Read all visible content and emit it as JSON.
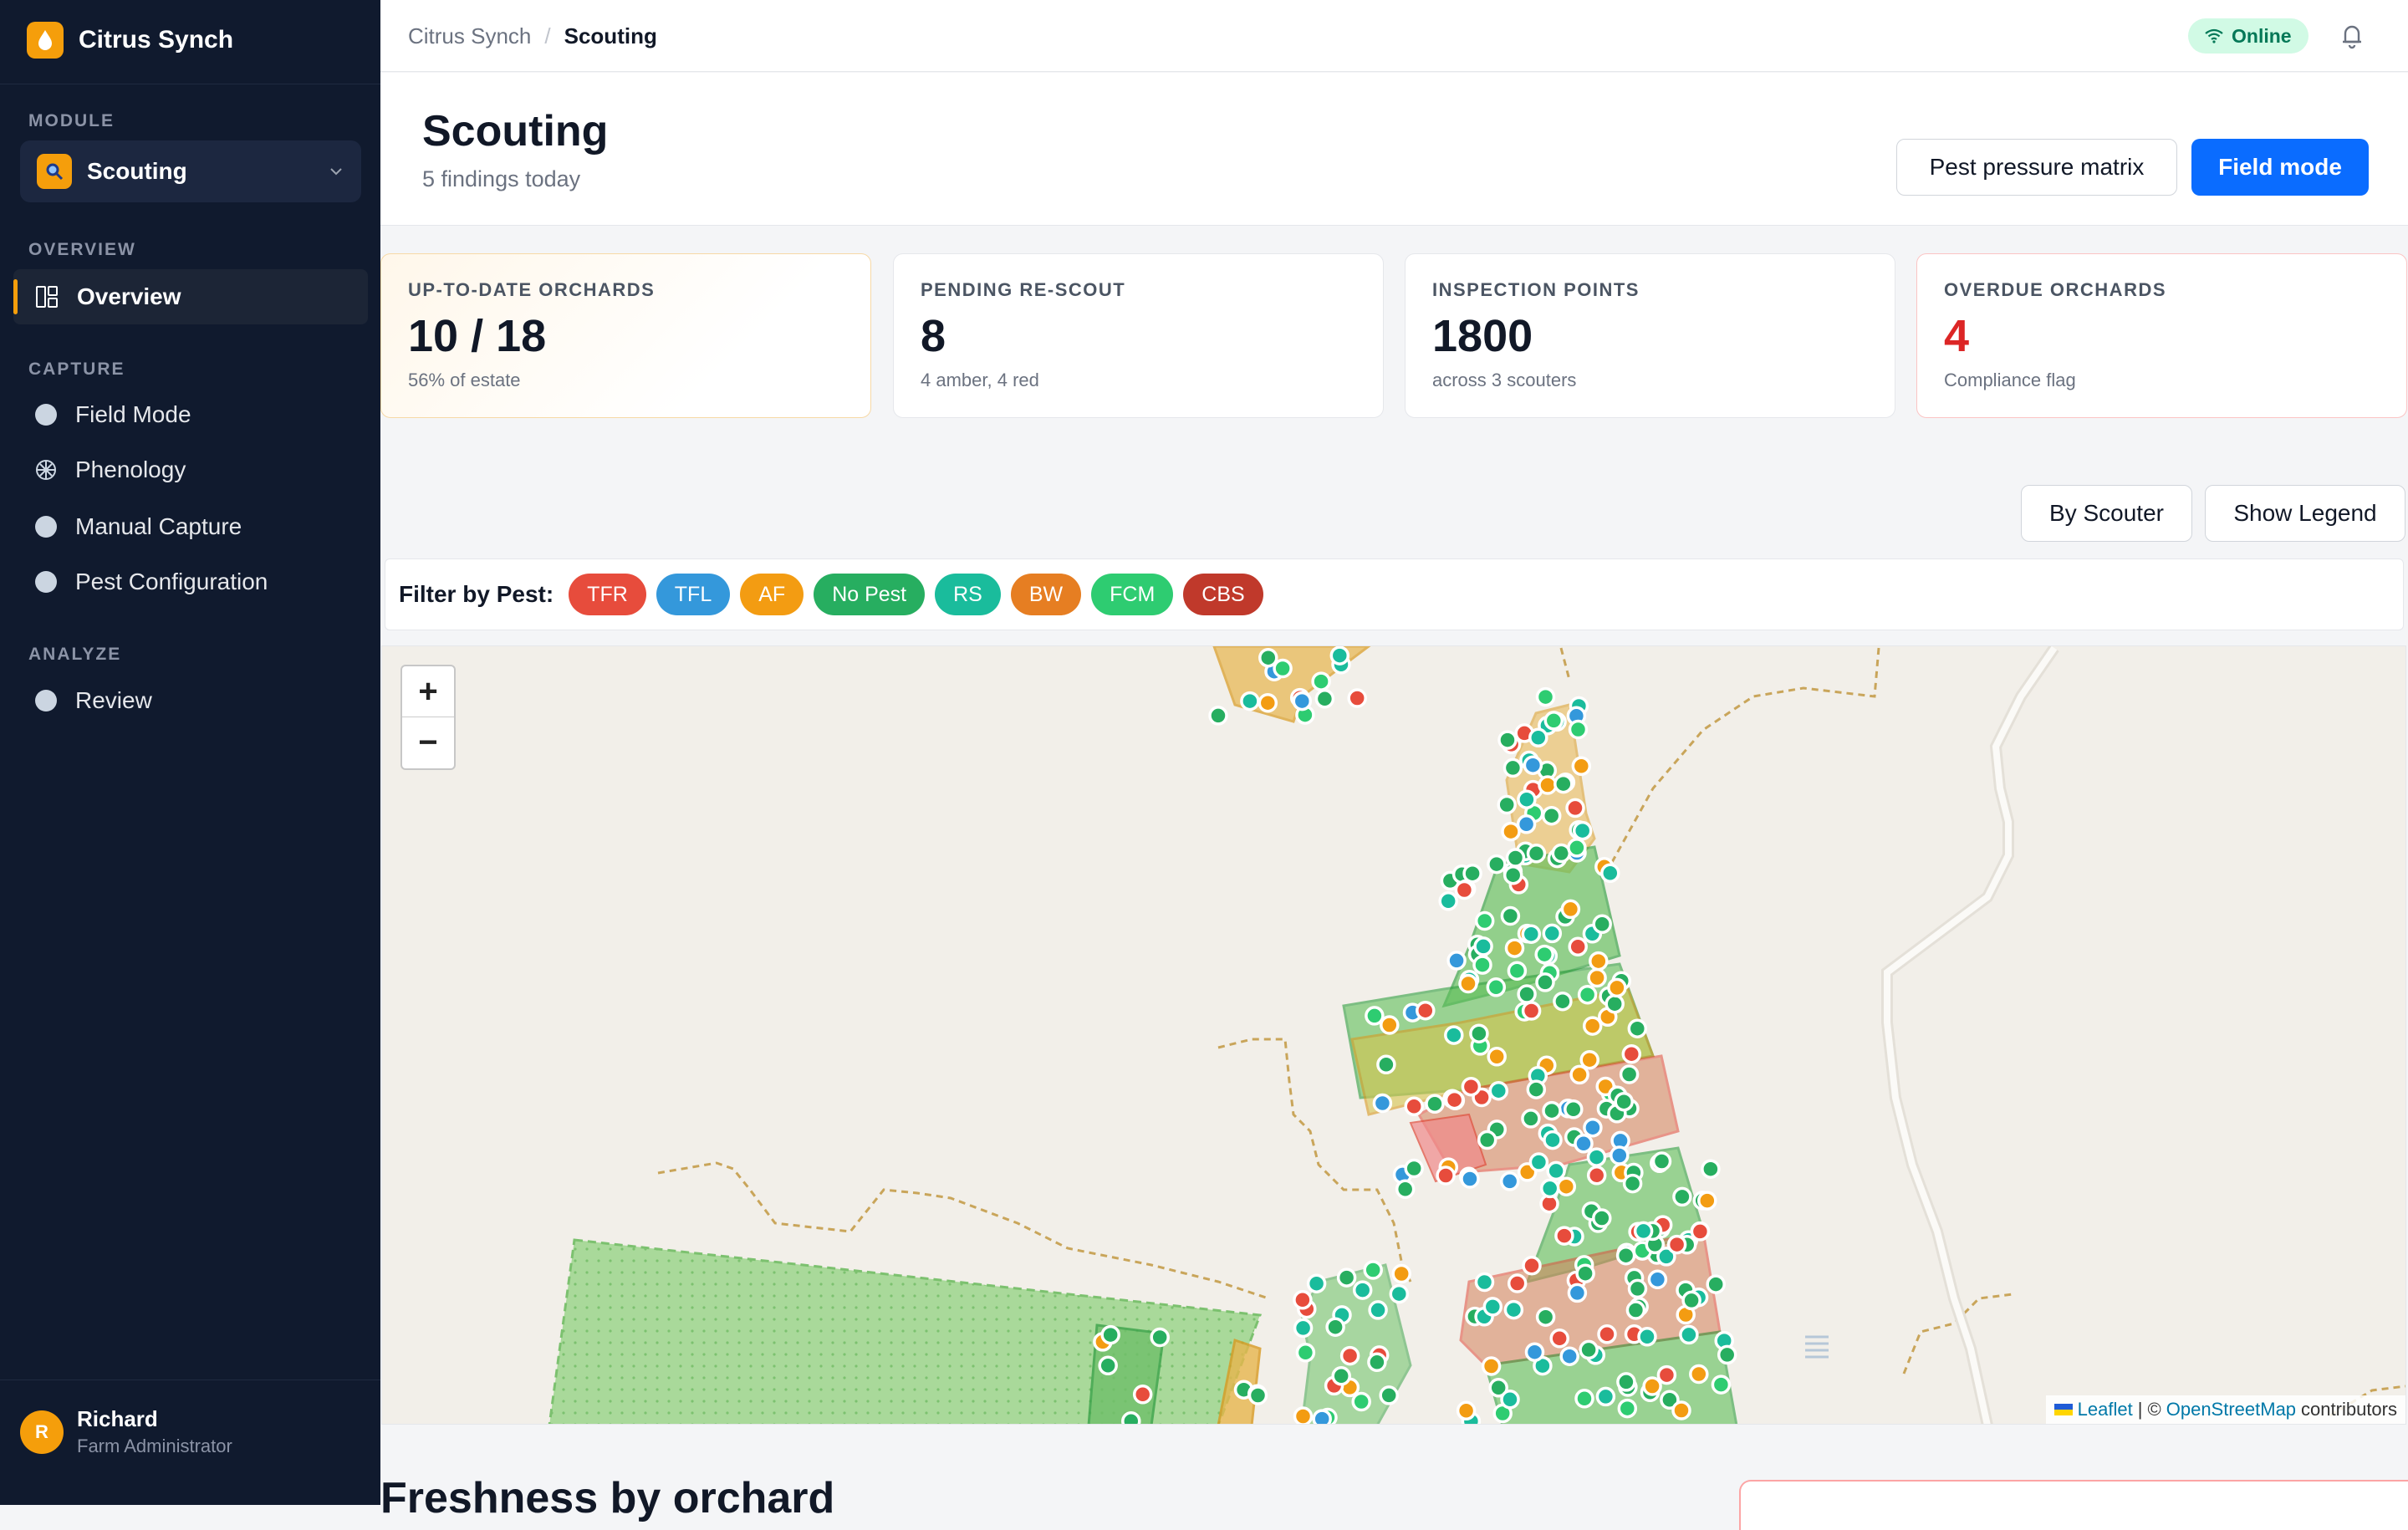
{
  "app": {
    "name": "Citrus Synch"
  },
  "sidebar": {
    "module_label": "MODULE",
    "module_value": "Scouting",
    "sections": [
      {
        "label": "OVERVIEW"
      },
      {
        "label": "CAPTURE"
      },
      {
        "label": "ANALYZE"
      }
    ],
    "items": [
      {
        "label": "Overview",
        "icon": "dashboard-icon",
        "active": true
      },
      {
        "label": "Field Mode",
        "icon": "circle-icon"
      },
      {
        "label": "Phenology",
        "icon": "flower-icon"
      },
      {
        "label": "Manual Capture",
        "icon": "circle-icon"
      },
      {
        "label": "Pest Configuration",
        "icon": "circle-icon"
      },
      {
        "label": "Review",
        "icon": "circle-icon"
      }
    ],
    "user": {
      "initial": "R",
      "name": "Richard",
      "role": "Farm Administrator"
    }
  },
  "topbar": {
    "breadcrumb": [
      "Citrus Synch",
      "/",
      "Scouting"
    ],
    "status": "Online",
    "status_color": "#047857"
  },
  "header": {
    "title": "Scouting",
    "subtitle": "5 findings today",
    "btn_matrix": "Pest pressure matrix",
    "btn_field": "Field mode"
  },
  "stats": [
    {
      "label": "UP-TO-DATE ORCHARDS",
      "value": "10 / 18",
      "sub": "56% of estate"
    },
    {
      "label": "PENDING RE-SCOUT",
      "value": "8",
      "sub": "4 amber, 4 red"
    },
    {
      "label": "INSPECTION POINTS",
      "value": "1800",
      "sub": "across 3 scouters"
    },
    {
      "label": "OVERDUE ORCHARDS",
      "value": "4",
      "sub": "Compliance flag"
    }
  ],
  "map_controls": {
    "by_scouter": "By Scouter",
    "show_legend": "Show Legend"
  },
  "filter": {
    "label": "Filter by Pest:",
    "chips": [
      {
        "label": "TFR",
        "color": "#e74c3c"
      },
      {
        "label": "TFL",
        "color": "#3498db"
      },
      {
        "label": "AF",
        "color": "#f39c12"
      },
      {
        "label": "No Pest",
        "color": "#27ae60"
      },
      {
        "label": "RS",
        "color": "#1abc9c"
      },
      {
        "label": "BW",
        "color": "#e67e22"
      },
      {
        "label": "FCM",
        "color": "#2ecc71"
      },
      {
        "label": "CBS",
        "color": "#c0392b"
      }
    ]
  },
  "map": {
    "zoom_in": "+",
    "zoom_out": "−",
    "attribution_leaflet": "Leaflet",
    "attribution_sep": "| ©",
    "attribution_osm": "OpenStreetMap",
    "attribution_tail": "contributors"
  },
  "section": {
    "title": "Freshness by orchard"
  }
}
